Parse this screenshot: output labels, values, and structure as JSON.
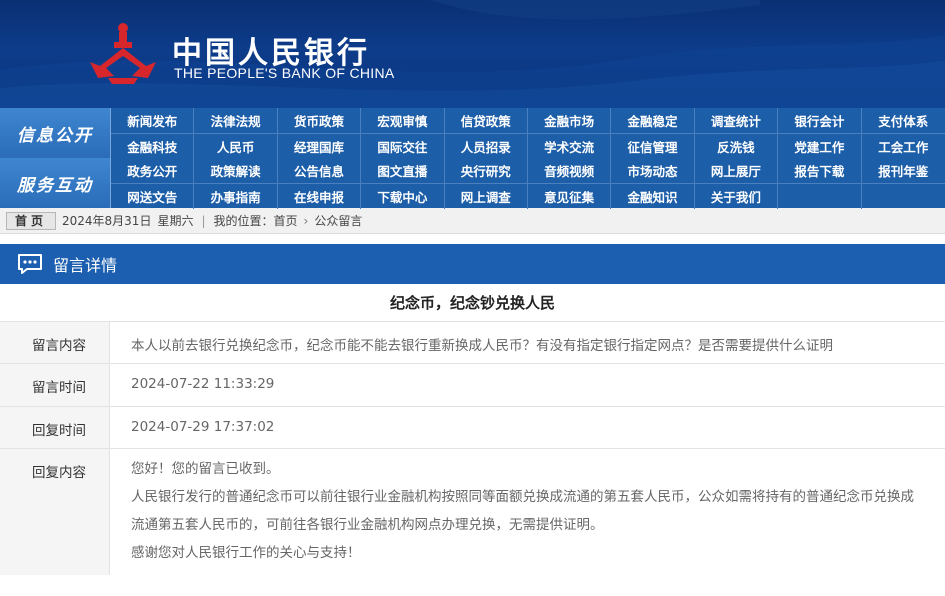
{
  "header": {
    "title_cn": "中国人民银行",
    "title_en": "THE PEOPLE'S BANK OF CHINA",
    "logo_icon": "pboc-emblem-icon"
  },
  "nav": {
    "sections": [
      {
        "label": "信息公开",
        "rows": [
          [
            "新闻发布",
            "法律法规",
            "货币政策",
            "宏观审慎",
            "信贷政策",
            "金融市场",
            "金融稳定",
            "调查统计",
            "银行会计",
            "支付体系"
          ],
          [
            "金融科技",
            "人民币",
            "经理国库",
            "国际交往",
            "人员招录",
            "学术交流",
            "征信管理",
            "反洗钱",
            "党建工作",
            "工会工作"
          ]
        ]
      },
      {
        "label": "服务互动",
        "rows": [
          [
            "政务公开",
            "政策解读",
            "公告信息",
            "图文直播",
            "央行研究",
            "音频视频",
            "市场动态",
            "网上展厅",
            "报告下载",
            "报刊年鉴"
          ],
          [
            "网送文告",
            "办事指南",
            "在线申报",
            "下载中心",
            "网上调查",
            "意见征集",
            "金融知识",
            "关于我们",
            "",
            ""
          ]
        ]
      }
    ]
  },
  "breadcrumb": {
    "home_label": "首页",
    "date": "2024年8月31日",
    "weekday": "星期六",
    "location_prefix": "我的位置：",
    "path": [
      "首页",
      "公众留言"
    ]
  },
  "section": {
    "title": "留言详情",
    "icon": "chat-bubble-icon"
  },
  "message": {
    "title": "纪念币，纪念钞兑换人民",
    "fields": {
      "content_label": "留言内容",
      "content_value": "本人以前去银行兑换纪念币，纪念币能不能去银行重新换成人民币？有没有指定银行指定网点？是否需要提供什么证明",
      "time_label": "留言时间",
      "time_value": "2024-07-22 11:33:29",
      "reply_time_label": "回复时间",
      "reply_time_value": "2024-07-29 17:37:02",
      "reply_label": "回复内容",
      "reply_paragraphs": [
        "您好！您的留言已收到。",
        "人民银行发行的普通纪念币可以前往银行业金融机构按照同等面额兑换成流通的第五套人民币，公众如需将持有的普通纪念币兑换成流通第五套人民币的，可前往各银行业金融机构网点办理兑换，无需提供证明。",
        "感谢您对人民银行工作的关心与支持！"
      ]
    }
  },
  "colors": {
    "header_bg": "#0d3c8a",
    "nav_bg": "#1d5ea9",
    "section_bg": "#1c5fb0",
    "logo_red": "#d7262c"
  }
}
